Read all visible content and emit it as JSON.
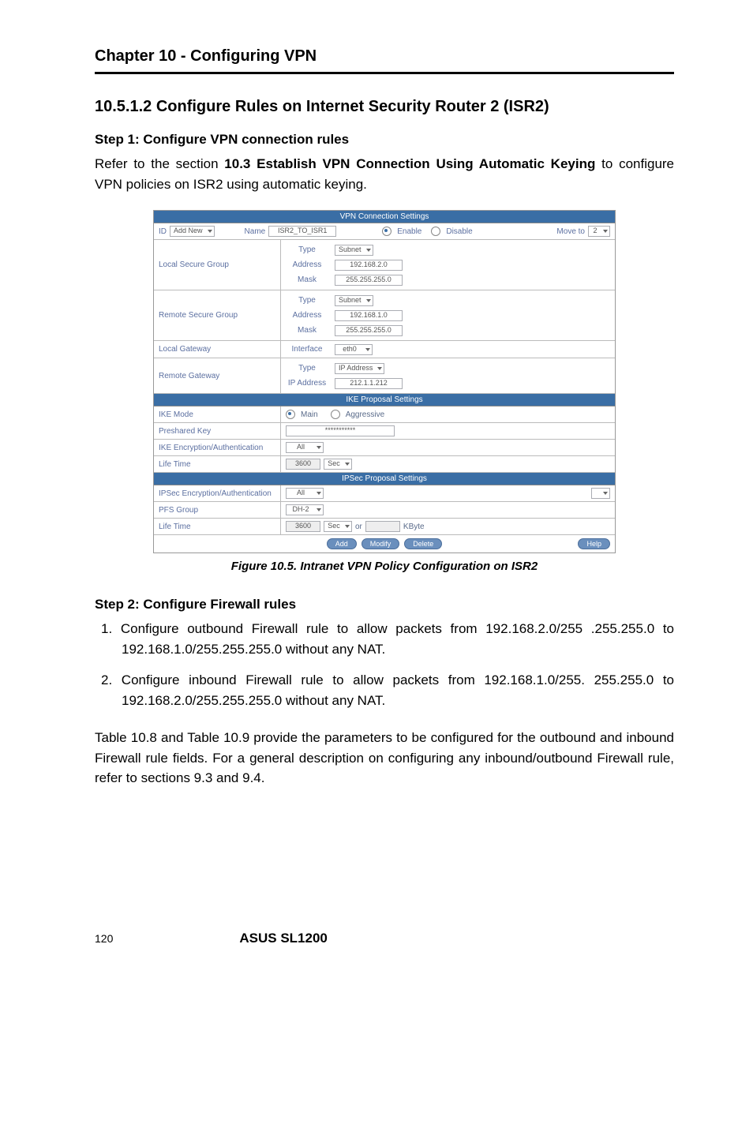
{
  "header": {
    "chapter_title": "Chapter 10 - Configuring VPN"
  },
  "section": {
    "heading": "10.5.1.2 Configure Rules on Internet Security Router 2 (ISR2)",
    "step1_heading": "Step 1: Configure VPN connection rules",
    "step1_para_pre": "Refer to the section ",
    "step1_para_bold": "10.3 Establish VPN Connection Using Automatic Keying",
    "step1_para_post": " to configure VPN policies on ISR2 using automatic keying.",
    "caption": "Figure 10.5. Intranet VPN Policy Configuration on ISR2",
    "step2_heading": "Step 2: Configure Firewall rules",
    "li1": "1. Configure outbound Firewall rule to allow packets from 192.168.2.0/255 .255.255.0 to 192.168.1.0/255.255.255.0 without any NAT.",
    "li2": "2. Configure inbound Firewall rule to allow packets from 192.168.1.0/255. 255.255.0 to 192.168.2.0/255.255.255.0 without any NAT.",
    "closing": "Table 10.8 and Table 10.9 provide the parameters to be configured for the outbound and inbound Firewall rule fields. For a general description on configuring any inbound/outbound Firewall rule, refer to sections 9.3 and 9.4."
  },
  "footer": {
    "page": "120",
    "brand": "ASUS SL1200"
  },
  "panel": {
    "band_top": "VPN Connection Settings",
    "band_ike": "IKE Proposal Settings",
    "band_ipsec": "IPSec Proposal Settings",
    "id_label": "ID",
    "id_select": "Add New",
    "name_label": "Name",
    "name_value": "ISR2_TO_ISR1",
    "enable": "Enable",
    "disable": "Disable",
    "moveto": "Move to",
    "moveto_val": "2",
    "local_secure_group": "Local Secure Group",
    "remote_secure_group": "Remote Secure Group",
    "local_gateway": "Local Gateway",
    "remote_gateway": "Remote Gateway",
    "type": "Type",
    "address": "Address",
    "mask": "Mask",
    "interface": "Interface",
    "ipaddress": "IP Address",
    "subnet": "Subnet",
    "eth0": "eth0",
    "ipaddress_opt": "IP Address",
    "lsg_addr": "192.168.2.0",
    "lsg_mask": "255.255.255.0",
    "rsg_addr": "192.168.1.0",
    "rsg_mask": "255.255.255.0",
    "rgw_addr": "212.1.1.212",
    "ike_mode": "IKE Mode",
    "main": "Main",
    "aggressive": "Aggressive",
    "preshared": "Preshared Key",
    "preshared_val": "***********",
    "ike_encauth": "IKE Encryption/Authentication",
    "all": "All",
    "lifetime": "Life Time",
    "lifetime_val": "3600",
    "sec": "Sec",
    "ipsec_encauth": "IPSec Encryption/Authentication",
    "pfs_group": "PFS Group",
    "dh2": "DH-2",
    "or": "or",
    "kbyte": "KByte",
    "btn_add": "Add",
    "btn_modify": "Modify",
    "btn_delete": "Delete",
    "btn_help": "Help"
  }
}
